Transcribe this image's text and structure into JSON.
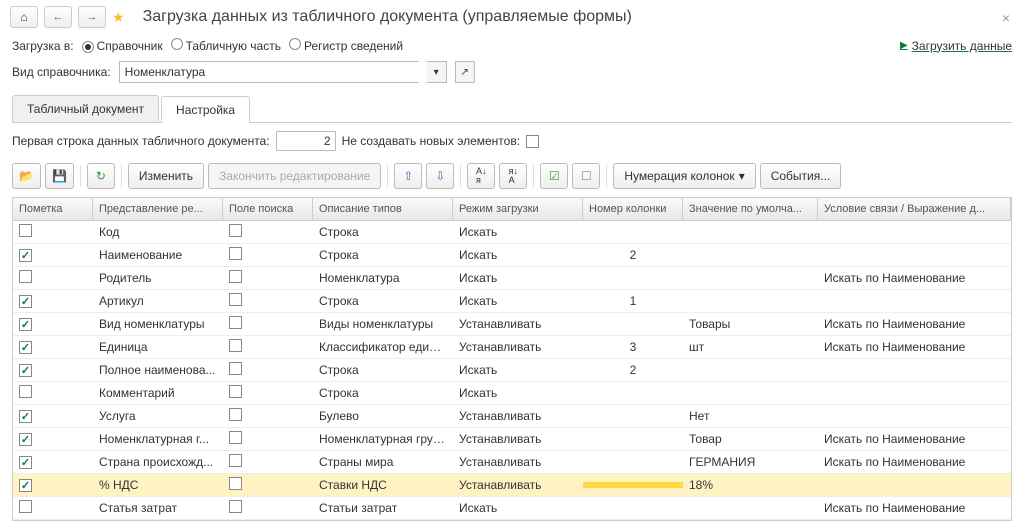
{
  "title": "Загрузка данных из табличного документа (управляемые формы)",
  "loadTo": {
    "label": "Загрузка в:",
    "opt1": "Справочник",
    "opt2": "Табличную часть",
    "opt3": "Регистр сведений"
  },
  "loadLink": "Загрузить данные",
  "refKind": {
    "label": "Вид справочника:",
    "value": "Номенклатура"
  },
  "tabs": {
    "t1": "Табличный документ",
    "t2": "Настройка"
  },
  "opts": {
    "firstRow": "Первая строка данных табличного документа:",
    "firstRowVal": "2",
    "noCreate": "Не создавать новых элементов:"
  },
  "tb": {
    "edit": "Изменить",
    "endEdit": "Закончить редактирование",
    "numCols": "Нумерация колонок",
    "events": "События..."
  },
  "cols": {
    "c0": "Пометка",
    "c1": "Представление ре...",
    "c2": "Поле поиска",
    "c3": "Описание типов",
    "c4": "Режим загрузки",
    "c5": "Номер колонки",
    "c6": "Значение по умолча...",
    "c7": "Условие связи / Выражение д..."
  },
  "rows": [
    {
      "chk": false,
      "name": "Код",
      "srch": false,
      "type": "Строка",
      "mode": "Искать",
      "num": "",
      "def": "",
      "cond": ""
    },
    {
      "chk": true,
      "name": "Наименование",
      "srch": false,
      "type": "Строка",
      "mode": "Искать",
      "num": "2",
      "def": "",
      "cond": ""
    },
    {
      "chk": false,
      "name": "Родитель",
      "srch": false,
      "type": "Номенклатура",
      "mode": "Искать",
      "num": "",
      "def": "",
      "cond": "Искать по Наименование"
    },
    {
      "chk": true,
      "name": "Артикул",
      "srch": false,
      "type": "Строка",
      "mode": "Искать",
      "num": "1",
      "def": "",
      "cond": ""
    },
    {
      "chk": true,
      "name": "Вид номенклатуры",
      "srch": false,
      "type": "Виды номенклатуры",
      "mode": "Устанавливать",
      "num": "",
      "def": "Товары",
      "cond": "Искать по Наименование"
    },
    {
      "chk": true,
      "name": "Единица",
      "srch": false,
      "type": "Классификатор едини...",
      "mode": "Устанавливать",
      "num": "3",
      "def": "шт",
      "cond": "Искать по Наименование"
    },
    {
      "chk": true,
      "name": "Полное наименова...",
      "srch": false,
      "type": "Строка",
      "mode": "Искать",
      "num": "2",
      "def": "",
      "cond": ""
    },
    {
      "chk": false,
      "name": "Комментарий",
      "srch": false,
      "type": "Строка",
      "mode": "Искать",
      "num": "",
      "def": "",
      "cond": ""
    },
    {
      "chk": true,
      "name": "Услуга",
      "srch": false,
      "type": "Булево",
      "mode": "Устанавливать",
      "num": "",
      "def": "Нет",
      "cond": ""
    },
    {
      "chk": true,
      "name": "Номенклатурная г...",
      "srch": false,
      "type": "Номенклатурная группа",
      "mode": "Устанавливать",
      "num": "",
      "def": "Товар",
      "cond": "Искать по Наименование"
    },
    {
      "chk": true,
      "name": "Страна происхожд...",
      "srch": false,
      "type": "Страны мира",
      "mode": "Устанавливать",
      "num": "",
      "def": "ГЕРМАНИЯ",
      "cond": "Искать по Наименование"
    },
    {
      "chk": true,
      "name": "% НДС",
      "srch": false,
      "type": "Ставки НДС",
      "mode": "Устанавливать",
      "num": "",
      "def": "18%",
      "cond": "",
      "sel": true
    },
    {
      "chk": false,
      "name": "Статья затрат",
      "srch": false,
      "type": "Статьи затрат",
      "mode": "Искать",
      "num": "",
      "def": "",
      "cond": "Искать по Наименование"
    }
  ]
}
